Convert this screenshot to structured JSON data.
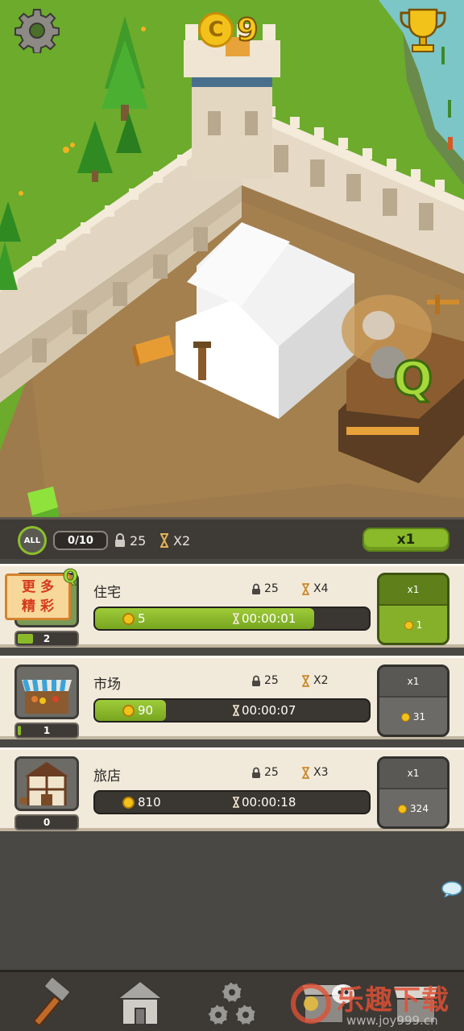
{
  "hud": {
    "coins": "9",
    "coin_symbol": "C",
    "settings_icon": "gear-icon",
    "trophy_icon": "trophy-icon"
  },
  "scene": {
    "quest_marker": "Q"
  },
  "status_bar": {
    "filter_label": "ALL",
    "slot_count": "0/10",
    "lock_value": "25",
    "speed_value": "X2",
    "multiplier_label": "x1"
  },
  "promo": {
    "line1": "更 多",
    "line2": "精 彩",
    "badge": "Q"
  },
  "buildings": [
    {
      "name": "住宅",
      "level": "2",
      "level_fill": 0.3,
      "lock": "25",
      "multiplier": "X4",
      "cost": "5",
      "time": "00:00:01",
      "progress": 0.8,
      "buy_qty": "x1",
      "buy_price": "1",
      "active": true
    },
    {
      "name": "市场",
      "level": "1",
      "level_fill": 0.1,
      "lock": "25",
      "multiplier": "X2",
      "cost": "90",
      "time": "00:00:07",
      "progress": 0.26,
      "buy_qty": "x1",
      "buy_price": "31",
      "active": false
    },
    {
      "name": "旅店",
      "level": "0",
      "level_fill": 0,
      "lock": "25",
      "multiplier": "X3",
      "cost": "810",
      "time": "00:00:18",
      "progress": 0,
      "buy_qty": "x1",
      "buy_price": "324",
      "active": false
    }
  ],
  "nav": [
    {
      "icon": "hammer-icon"
    },
    {
      "icon": "house-icon"
    },
    {
      "icon": "gears-icon"
    },
    {
      "icon": "shop-icon"
    },
    {
      "icon": "market-icon"
    }
  ],
  "watermark": {
    "text": "乐趣下载",
    "url": "www.joy999.cn"
  }
}
